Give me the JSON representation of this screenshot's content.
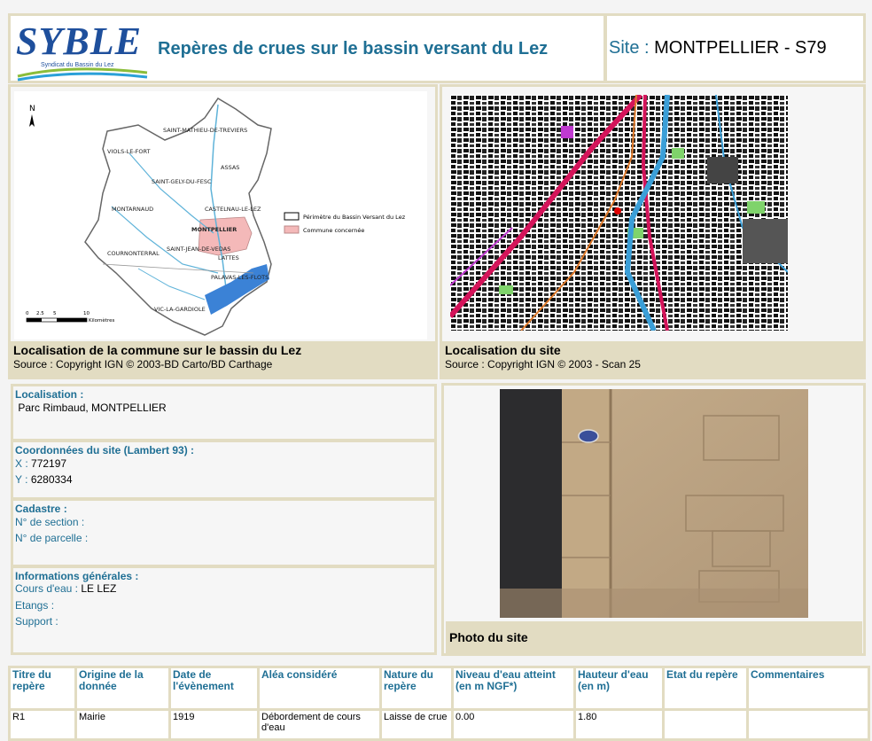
{
  "header": {
    "logo": {
      "text": "SYBLE",
      "subtitle": "Syndicat du Bassin du Lez"
    },
    "title": "Repères de crues sur le bassin versant du Lez",
    "site_label": "Site :",
    "site_value": "MONTPELLIER - S79"
  },
  "map_commune": {
    "title": "Localisation de la commune sur le bassin du Lez",
    "source": "Source : Copyright IGN © 2003-BD Carto/BD Carthage",
    "north": "N",
    "places": [
      "SAINT-MATHIEU-DE-TREVIERS",
      "VIOLS-LE-FORT",
      "ASSAS",
      "SAINT-GELY-DU-FESC",
      "MONTARNAUD",
      "CASTELNAU-LE-LEZ",
      "MONTPELLIER",
      "COURNONTERRAL",
      "SAINT-JEAN-DE-VEDAS",
      "LATTES",
      "PALAVAS-LES-FLOTS",
      "VIC-LA-GARDIOLE"
    ],
    "legend": [
      "Périmètre du Bassin Versant du Lez",
      "Commune concernée"
    ],
    "scale": [
      "0",
      "2.5",
      "5",
      "10",
      "Kilomètres"
    ],
    "colors": {
      "commune": "#f4b9b9",
      "water": "#3b82d6",
      "river": "#5fb3d9"
    }
  },
  "map_site": {
    "title": "Localisation du site",
    "source": "Source : Copyright IGN © 2003 - Scan 25"
  },
  "localisation": {
    "label": "Localisation :",
    "value": " Parc Rimbaud, MONTPELLIER"
  },
  "coordinates": {
    "label": "Coordonnées du site (Lambert 93) :",
    "x_label": "X :",
    "x_value": "772197",
    "y_label": "Y :",
    "y_value": "6280334"
  },
  "cadastre": {
    "label": "Cadastre :",
    "section_label": "N° de section :",
    "section_value": "",
    "parcelle_label": "N° de parcelle :",
    "parcelle_value": ""
  },
  "general_info": {
    "label": "Informations générales :",
    "cours_label": "Cours d'eau :",
    "cours_value": "LE LEZ",
    "etangs_label": "Etangs :",
    "etangs_value": "",
    "support_label": "Support :",
    "support_value": ""
  },
  "photo": {
    "caption": "Photo du site"
  },
  "table": {
    "headers": {
      "titre": "Titre du repère",
      "origine": "Origine de la donnée",
      "date": "Date de l'évènement",
      "alea": "Aléa considéré",
      "nature": "Nature du repère",
      "niveau": "Niveau d'eau atteint (en m NGF*)",
      "hauteur": "Hauteur d'eau (en m)",
      "etat": "Etat du repère",
      "commentaires": "Commentaires"
    },
    "rows": [
      {
        "titre": "R1",
        "origine": "Mairie",
        "date": "1919",
        "alea": "Débordement de cours d'eau",
        "nature": "Laisse de crue",
        "niveau": "0.00",
        "hauteur": "1.80",
        "etat": "",
        "commentaires": ""
      }
    ]
  }
}
